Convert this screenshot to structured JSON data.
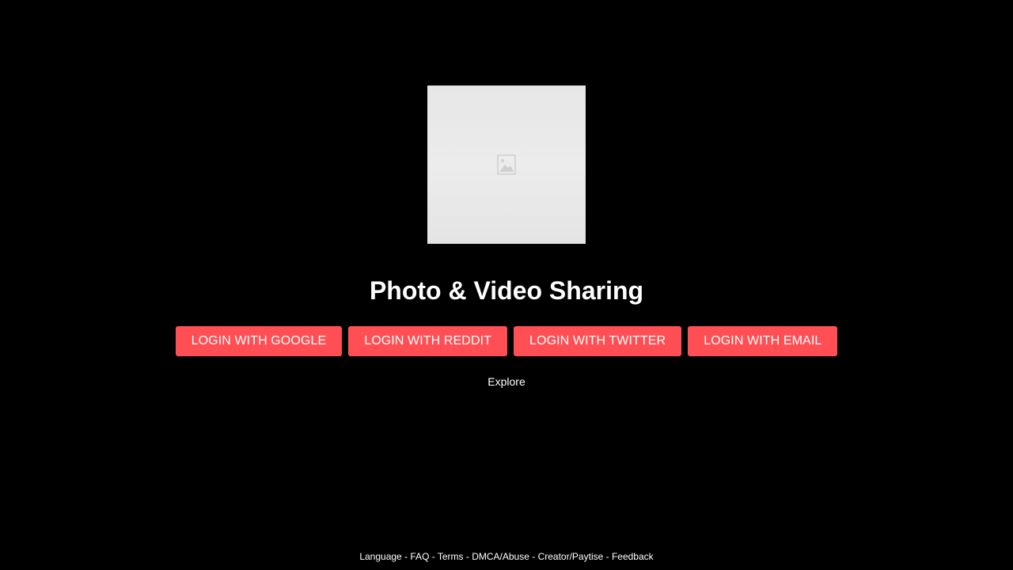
{
  "hero": {
    "image_icon": "broken-image-icon"
  },
  "title": "Photo & Video Sharing",
  "login_buttons": [
    {
      "label": "LOGIN WITH GOOGLE"
    },
    {
      "label": "LOGIN WITH REDDIT"
    },
    {
      "label": "LOGIN WITH TWITTER"
    },
    {
      "label": "LOGIN WITH EMAIL"
    }
  ],
  "explore_label": "Explore",
  "footer": {
    "separator": " - ",
    "links": [
      {
        "label": "Language"
      },
      {
        "label": "FAQ"
      },
      {
        "label": "Terms"
      },
      {
        "label": "DMCA/Abuse"
      },
      {
        "label": "Creator/Paytise"
      },
      {
        "label": "Feedback"
      }
    ]
  },
  "colors": {
    "background": "#000000",
    "button": "#ff4f55",
    "text": "#ffffff"
  }
}
